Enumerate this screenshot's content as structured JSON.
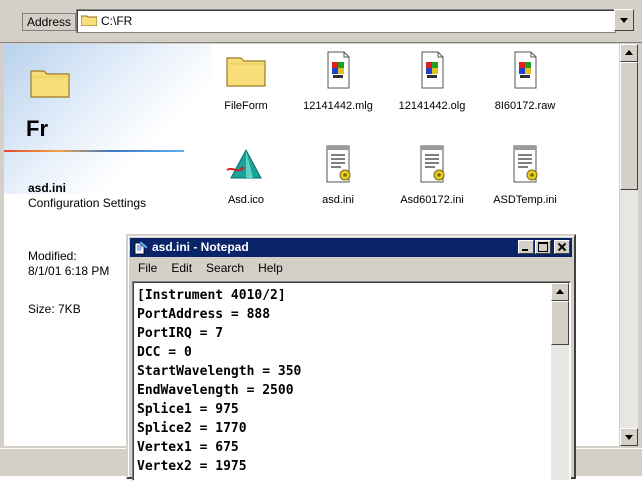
{
  "address_bar": {
    "label": "Address",
    "path": "C:\\FR"
  },
  "info_panel": {
    "folder_title": "Fr",
    "file_name": "asd.ini",
    "file_type": "Configuration Settings",
    "modified_label": "Modified:",
    "modified_value": "8/1/01 6:18 PM",
    "size": "Size: 7KB"
  },
  "files": [
    {
      "name": "FileForm",
      "icon": "folder-icon"
    },
    {
      "name": "12141442.mlg",
      "icon": "binary-file-icon"
    },
    {
      "name": "12141442.olg",
      "icon": "binary-file-icon"
    },
    {
      "name": "8I60172.raw",
      "icon": "binary-file-icon"
    },
    {
      "name": "Asd.ico",
      "icon": "asd-icon"
    },
    {
      "name": "asd.ini",
      "icon": "ini-settings-icon"
    },
    {
      "name": "Asd60172.ini",
      "icon": "ini-settings-icon"
    },
    {
      "name": "ASDTemp.ini",
      "icon": "ini-settings-icon"
    }
  ],
  "notepad": {
    "title": "asd.ini - Notepad",
    "menu": [
      "File",
      "Edit",
      "Search",
      "Help"
    ],
    "lines": [
      "[Instrument 4010/2]",
      "PortAddress = 888",
      "PortIRQ = 7",
      "DCC = 0",
      "StartWavelength = 350",
      "EndWavelength = 2500",
      "Splice1 = 975",
      "Splice2 = 1770",
      "Vertex1 = 675",
      "Vertex2 = 1975"
    ]
  },
  "colors": {
    "titlebar": "#0a246a",
    "face": "#d4d0c8",
    "folder": "#f7de7a"
  }
}
